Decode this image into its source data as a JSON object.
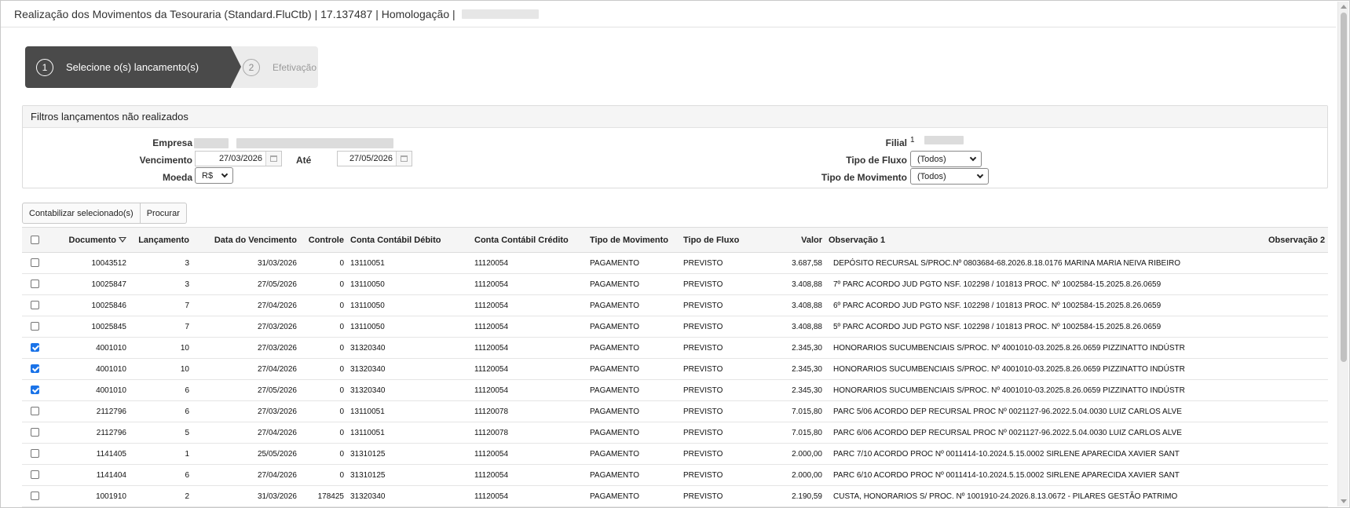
{
  "window": {
    "title": "Realização dos Movimentos da Tesouraria (Standard.FluCtb) | 17.137487 | Homologação |"
  },
  "wizard": {
    "steps": [
      {
        "number": "1",
        "label": "Selecione o(s) lancamento(s)",
        "active": true
      },
      {
        "number": "2",
        "label": "Efetivação",
        "active": false
      }
    ]
  },
  "filters": {
    "title": "Filtros lançamentos não realizados",
    "empresa_label": "Empresa",
    "vencimento_label": "Vencimento",
    "vencimento_de": "27/03/2026",
    "ate_label": "Até",
    "vencimento_ate": "27/05/2026",
    "moeda_label": "Moeda",
    "moeda_value": "R$",
    "filial_label": "Filial",
    "filial_value": "1",
    "tipo_fluxo_label": "Tipo de Fluxo",
    "tipo_fluxo_value": "(Todos)",
    "tipo_movimento_label": "Tipo de Movimento",
    "tipo_movimento_value": "(Todos)"
  },
  "toolbar": {
    "contabilizar_label": "Contabilizar selecionado(s)",
    "procurar_label": "Procurar"
  },
  "table": {
    "columns": [
      "Documento",
      "Lançamento",
      "Data do Vencimento",
      "Controle",
      "Conta Contábil Débito",
      "Conta Contábil Crédito",
      "Tipo de Movimento",
      "Tipo de Fluxo",
      "Valor",
      "Observação 1",
      "Observação 2"
    ],
    "rows": [
      {
        "checked": false,
        "documento": "10043512",
        "lancamento": "3",
        "vencimento": "31/03/2026",
        "controle": "0",
        "debito": "13110051",
        "credito": "11120054",
        "tipo_movimento": "PAGAMENTO",
        "tipo_fluxo": "PREVISTO",
        "valor": "3.687,58",
        "obs1": "DEPÓSITO RECURSAL S/PROC.Nº 0803684-68.2026.8.18.0176 MARINA MARIA NEIVA RIBEIRO",
        "obs2": ""
      },
      {
        "checked": false,
        "documento": "10025847",
        "lancamento": "3",
        "vencimento": "27/05/2026",
        "controle": "0",
        "debito": "13110050",
        "credito": "11120054",
        "tipo_movimento": "PAGAMENTO",
        "tipo_fluxo": "PREVISTO",
        "valor": "3.408,88",
        "obs1": "7º PARC ACORDO JUD PGTO NSF. 102298 / 101813 PROC. Nº 1002584-15.2025.8.26.0659",
        "obs2": ""
      },
      {
        "checked": false,
        "documento": "10025846",
        "lancamento": "7",
        "vencimento": "27/04/2026",
        "controle": "0",
        "debito": "13110050",
        "credito": "11120054",
        "tipo_movimento": "PAGAMENTO",
        "tipo_fluxo": "PREVISTO",
        "valor": "3.408,88",
        "obs1": "6º PARC ACORDO JUD PGTO NSF. 102298 / 101813 PROC. Nº 1002584-15.2025.8.26.0659",
        "obs2": ""
      },
      {
        "checked": false,
        "documento": "10025845",
        "lancamento": "7",
        "vencimento": "27/03/2026",
        "controle": "0",
        "debito": "13110050",
        "credito": "11120054",
        "tipo_movimento": "PAGAMENTO",
        "tipo_fluxo": "PREVISTO",
        "valor": "3.408,88",
        "obs1": "5º PARC ACORDO JUD PGTO NSF. 102298 / 101813 PROC. Nº 1002584-15.2025.8.26.0659",
        "obs2": ""
      },
      {
        "checked": true,
        "documento": "4001010",
        "lancamento": "10",
        "vencimento": "27/03/2026",
        "controle": "0",
        "debito": "31320340",
        "credito": "11120054",
        "tipo_movimento": "PAGAMENTO",
        "tipo_fluxo": "PREVISTO",
        "valor": "2.345,30",
        "obs1": "HONORARIOS SUCUMBENCIAIS S/PROC. Nº 4001010-03.2025.8.26.0659 PIZZINATTO INDÚSTR",
        "obs2": ""
      },
      {
        "checked": true,
        "documento": "4001010",
        "lancamento": "10",
        "vencimento": "27/04/2026",
        "controle": "0",
        "debito": "31320340",
        "credito": "11120054",
        "tipo_movimento": "PAGAMENTO",
        "tipo_fluxo": "PREVISTO",
        "valor": "2.345,30",
        "obs1": "HONORARIOS SUCUMBENCIAIS S/PROC. Nº 4001010-03.2025.8.26.0659 PIZZINATTO INDÚSTR",
        "obs2": ""
      },
      {
        "checked": true,
        "documento": "4001010",
        "lancamento": "6",
        "vencimento": "27/05/2026",
        "controle": "0",
        "debito": "31320340",
        "credito": "11120054",
        "tipo_movimento": "PAGAMENTO",
        "tipo_fluxo": "PREVISTO",
        "valor": "2.345,30",
        "obs1": "HONORARIOS SUCUMBENCIAIS S/PROC. Nº 4001010-03.2025.8.26.0659 PIZZINATTO INDÚSTR",
        "obs2": ""
      },
      {
        "checked": false,
        "documento": "2112796",
        "lancamento": "6",
        "vencimento": "27/03/2026",
        "controle": "0",
        "debito": "13110051",
        "credito": "11120078",
        "tipo_movimento": "PAGAMENTO",
        "tipo_fluxo": "PREVISTO",
        "valor": "7.015,80",
        "obs1": "PARC 5/06 ACORDO DEP RECURSAL PROC Nº 0021127-96.2022.5.04.0030 LUIZ CARLOS ALVE",
        "obs2": ""
      },
      {
        "checked": false,
        "documento": "2112796",
        "lancamento": "5",
        "vencimento": "27/04/2026",
        "controle": "0",
        "debito": "13110051",
        "credito": "11120078",
        "tipo_movimento": "PAGAMENTO",
        "tipo_fluxo": "PREVISTO",
        "valor": "7.015,80",
        "obs1": "PARC 6/06 ACORDO DEP RECURSAL PROC Nº 0021127-96.2022.5.04.0030 LUIZ CARLOS ALVE",
        "obs2": ""
      },
      {
        "checked": false,
        "documento": "1141405",
        "lancamento": "1",
        "vencimento": "25/05/2026",
        "controle": "0",
        "debito": "31310125",
        "credito": "11120054",
        "tipo_movimento": "PAGAMENTO",
        "tipo_fluxo": "PREVISTO",
        "valor": "2.000,00",
        "obs1": "PARC 7/10 ACORDO PROC Nº 0011414-10.2024.5.15.0002 SIRLENE APARECIDA XAVIER SANT",
        "obs2": ""
      },
      {
        "checked": false,
        "documento": "1141404",
        "lancamento": "6",
        "vencimento": "27/04/2026",
        "controle": "0",
        "debito": "31310125",
        "credito": "11120054",
        "tipo_movimento": "PAGAMENTO",
        "tipo_fluxo": "PREVISTO",
        "valor": "2.000,00",
        "obs1": "PARC 6/10 ACORDO PROC Nº 0011414-10.2024.5.15.0002 SIRLENE APARECIDA XAVIER SANT",
        "obs2": ""
      },
      {
        "checked": false,
        "documento": "1001910",
        "lancamento": "2",
        "vencimento": "31/03/2026",
        "controle": "178425",
        "debito": "31320340",
        "credito": "11120054",
        "tipo_movimento": "PAGAMENTO",
        "tipo_fluxo": "PREVISTO",
        "valor": "2.190,59",
        "obs1": "CUSTA, HONORARIOS S/ PROC. Nº 1001910-24.2026.8.13.0672 - PILARES GESTÃO PATRIMO",
        "obs2": ""
      }
    ]
  }
}
